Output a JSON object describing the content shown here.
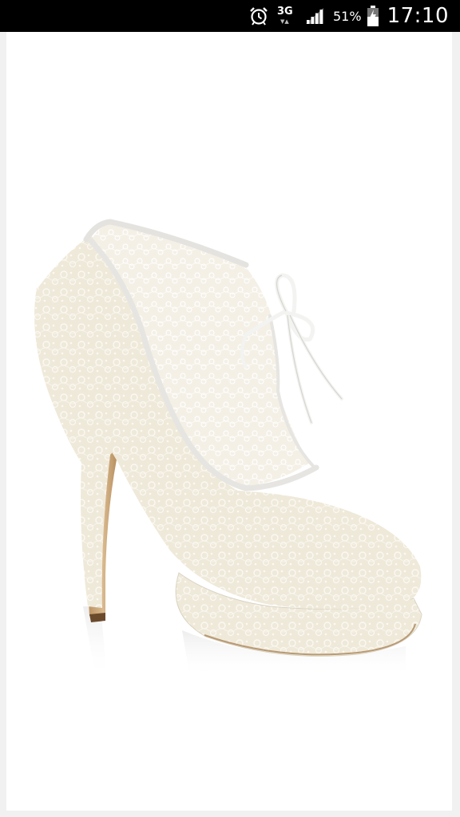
{
  "status_bar": {
    "network_type": "3G",
    "battery_percent": "51%",
    "time": "17:10",
    "icons": [
      "alarm-icon",
      "network-3g-icon",
      "signal-icon",
      "battery-charging-icon"
    ]
  },
  "viewer": {
    "image_subject": "lace-platform-ankle-bootie",
    "background_color": "#ffffff",
    "lace_color": "#f3efe4",
    "trim_color": "#e6e6e3",
    "heel_color": "#c9a57a"
  }
}
